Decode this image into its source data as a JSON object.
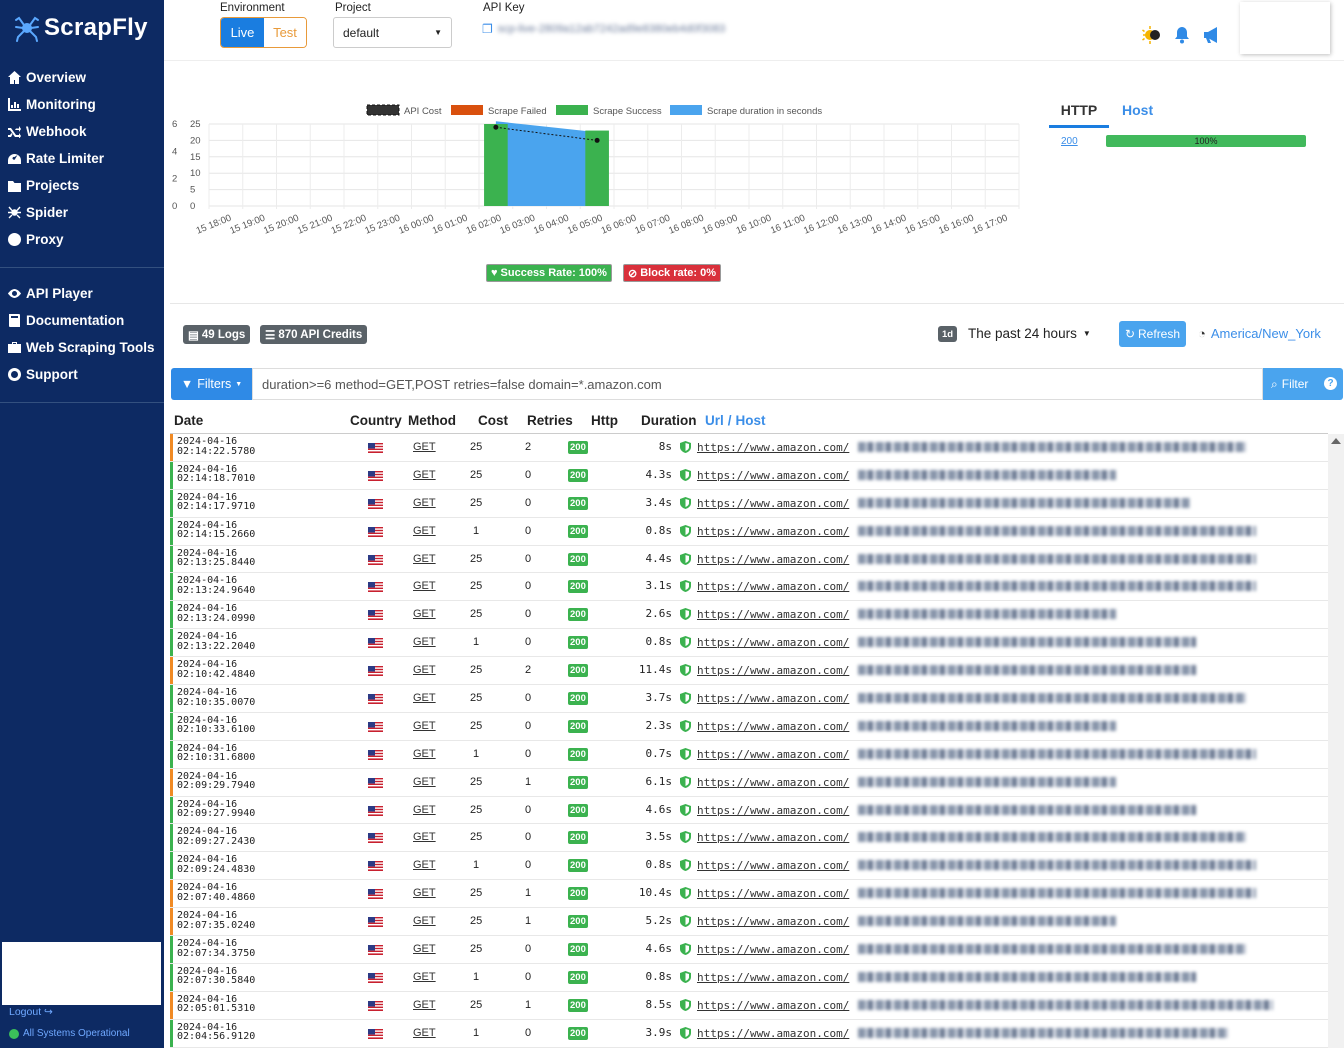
{
  "brand": {
    "name": "ScrapFly"
  },
  "sidebar": {
    "nav_primary": [
      {
        "label": "Overview",
        "icon": "home-icon"
      },
      {
        "label": "Monitoring",
        "icon": "chart-icon"
      },
      {
        "label": "Webhook",
        "icon": "shuffle-icon"
      },
      {
        "label": "Rate Limiter",
        "icon": "speedometer-icon"
      },
      {
        "label": "Projects",
        "icon": "folder-icon"
      },
      {
        "label": "Spider",
        "icon": "spider-icon"
      },
      {
        "label": "Proxy",
        "icon": "globe-icon"
      }
    ],
    "nav_secondary": [
      {
        "label": "API Player",
        "icon": "eye-icon"
      },
      {
        "label": "Documentation",
        "icon": "book-icon"
      },
      {
        "label": "Web Scraping Tools",
        "icon": "briefcase-icon"
      },
      {
        "label": "Support",
        "icon": "lifebuoy-icon"
      }
    ],
    "logout": "Logout",
    "status": "All Systems Operational"
  },
  "header": {
    "environment_label": "Environment",
    "env_live": "Live",
    "env_test": "Test",
    "project_label": "Project",
    "project_value": "default",
    "api_key_label": "API Key",
    "api_key_value": "scp-live-2809a12ab7242ad9e8380eb4d0f3083"
  },
  "chart_data": {
    "type": "bar",
    "legend": [
      "API Cost",
      "Scrape Failed",
      "Scrape Success",
      "Scrape duration in seconds"
    ],
    "categories": [
      "15 18:00",
      "15 19:00",
      "15 20:00",
      "15 21:00",
      "15 22:00",
      "15 23:00",
      "16 00:00",
      "16 01:00",
      "16 02:00",
      "16 03:00",
      "16 04:00",
      "16 05:00",
      "16 06:00",
      "16 07:00",
      "16 08:00",
      "16 09:00",
      "16 10:00",
      "16 11:00",
      "16 12:00",
      "16 13:00",
      "16 14:00",
      "16 15:00",
      "16 16:00",
      "16 17:00"
    ],
    "y_left_ticks": [
      "0",
      "2",
      "4",
      "6"
    ],
    "y_right_ticks": [
      "0",
      "5",
      "10",
      "15",
      "20",
      "25"
    ],
    "success_bars": [
      {
        "category": "16 02:00",
        "value": 25
      },
      {
        "category": "16 05:00",
        "value": 23
      }
    ],
    "duration_area": [
      {
        "category": "16 02:00",
        "value": 6.2
      },
      {
        "category": "16 05:00",
        "value": 5.4
      }
    ],
    "cost_points": [
      {
        "category": "16 02:00",
        "value": 24
      },
      {
        "category": "16 05:00",
        "value": 20
      }
    ]
  },
  "badges": {
    "success_rate": "Success Rate: 100%",
    "block_rate": "Block rate: 0%"
  },
  "http_panel": {
    "tab_http": "HTTP",
    "tab_host": "Host",
    "code": "200",
    "percent": "100%"
  },
  "stats": {
    "logs": "49 Logs",
    "credits": "870 API Credits",
    "period_badge": "1d",
    "period": "The past 24 hours",
    "refresh": "Refresh",
    "timezone": "America/New_York"
  },
  "filter": {
    "button": "Filters",
    "query": "duration>=6 method=GET,POST retries=false domain=*.amazon.com",
    "apply": "Filter",
    "help": "?"
  },
  "table": {
    "headers": {
      "date": "Date",
      "country": "Country",
      "method": "Method",
      "cost": "Cost",
      "retries": "Retries",
      "http": "Http",
      "duration": "Duration",
      "url": "Url",
      "slash": "/",
      "host": "Host"
    },
    "rows": [
      {
        "d": "2024-04-16",
        "t": "02:14:22.5780",
        "method": "GET",
        "cost": "25",
        "retries": "2",
        "http": "200",
        "dur": "8s",
        "url": "https://www.amazon.com/",
        "edge": "#f08a24",
        "pw": 388
      },
      {
        "d": "2024-04-16",
        "t": "02:14:18.7010",
        "method": "GET",
        "cost": "25",
        "retries": "0",
        "http": "200",
        "dur": "4.3s",
        "url": "https://www.amazon.com/",
        "edge": "#3bb24f",
        "pw": 258
      },
      {
        "d": "2024-04-16",
        "t": "02:14:17.9710",
        "method": "GET",
        "cost": "25",
        "retries": "0",
        "http": "200",
        "dur": "3.4s",
        "url": "https://www.amazon.com/",
        "edge": "#3bb24f",
        "pw": 332
      },
      {
        "d": "2024-04-16",
        "t": "02:14:15.2660",
        "method": "GET",
        "cost": "1",
        "retries": "0",
        "http": "200",
        "dur": "0.8s",
        "url": "https://www.amazon.com/",
        "edge": "#3bb24f",
        "pw": 398
      },
      {
        "d": "2024-04-16",
        "t": "02:13:25.8440",
        "method": "GET",
        "cost": "25",
        "retries": "0",
        "http": "200",
        "dur": "4.4s",
        "url": "https://www.amazon.com/",
        "edge": "#3bb24f",
        "pw": 398
      },
      {
        "d": "2024-04-16",
        "t": "02:13:24.9640",
        "method": "GET",
        "cost": "25",
        "retries": "0",
        "http": "200",
        "dur": "3.1s",
        "url": "https://www.amazon.com/",
        "edge": "#3bb24f",
        "pw": 398
      },
      {
        "d": "2024-04-16",
        "t": "02:13:24.0990",
        "method": "GET",
        "cost": "25",
        "retries": "0",
        "http": "200",
        "dur": "2.6s",
        "url": "https://www.amazon.com/",
        "edge": "#3bb24f",
        "pw": 258
      },
      {
        "d": "2024-04-16",
        "t": "02:13:22.2040",
        "method": "GET",
        "cost": "1",
        "retries": "0",
        "http": "200",
        "dur": "0.8s",
        "url": "https://www.amazon.com/",
        "edge": "#3bb24f",
        "pw": 338
      },
      {
        "d": "2024-04-16",
        "t": "02:10:42.4840",
        "method": "GET",
        "cost": "25",
        "retries": "2",
        "http": "200",
        "dur": "11.4s",
        "url": "https://www.amazon.com/",
        "edge": "#f08a24",
        "pw": 338
      },
      {
        "d": "2024-04-16",
        "t": "02:10:35.0070",
        "method": "GET",
        "cost": "25",
        "retries": "0",
        "http": "200",
        "dur": "3.7s",
        "url": "https://www.amazon.com/",
        "edge": "#3bb24f",
        "pw": 388
      },
      {
        "d": "2024-04-16",
        "t": "02:10:33.6100",
        "method": "GET",
        "cost": "25",
        "retries": "0",
        "http": "200",
        "dur": "2.3s",
        "url": "https://www.amazon.com/",
        "edge": "#3bb24f",
        "pw": 258
      },
      {
        "d": "2024-04-16",
        "t": "02:10:31.6800",
        "method": "GET",
        "cost": "1",
        "retries": "0",
        "http": "200",
        "dur": "0.7s",
        "url": "https://www.amazon.com/",
        "edge": "#3bb24f",
        "pw": 398
      },
      {
        "d": "2024-04-16",
        "t": "02:09:29.7940",
        "method": "GET",
        "cost": "25",
        "retries": "1",
        "http": "200",
        "dur": "6.1s",
        "url": "https://www.amazon.com/",
        "edge": "#f08a24",
        "pw": 258
      },
      {
        "d": "2024-04-16",
        "t": "02:09:27.9940",
        "method": "GET",
        "cost": "25",
        "retries": "0",
        "http": "200",
        "dur": "4.6s",
        "url": "https://www.amazon.com/",
        "edge": "#3bb24f",
        "pw": 338
      },
      {
        "d": "2024-04-16",
        "t": "02:09:27.2430",
        "method": "GET",
        "cost": "25",
        "retries": "0",
        "http": "200",
        "dur": "3.5s",
        "url": "https://www.amazon.com/",
        "edge": "#3bb24f",
        "pw": 388
      },
      {
        "d": "2024-04-16",
        "t": "02:09:24.4830",
        "method": "GET",
        "cost": "1",
        "retries": "0",
        "http": "200",
        "dur": "0.8s",
        "url": "https://www.amazon.com/",
        "edge": "#3bb24f",
        "pw": 398
      },
      {
        "d": "2024-04-16",
        "t": "02:07:40.4860",
        "method": "GET",
        "cost": "25",
        "retries": "1",
        "http": "200",
        "dur": "10.4s",
        "url": "https://www.amazon.com/",
        "edge": "#f08a24",
        "pw": 398
      },
      {
        "d": "2024-04-16",
        "t": "02:07:35.0240",
        "method": "GET",
        "cost": "25",
        "retries": "1",
        "http": "200",
        "dur": "5.2s",
        "url": "https://www.amazon.com/",
        "edge": "#f08a24",
        "pw": 258
      },
      {
        "d": "2024-04-16",
        "t": "02:07:34.3750",
        "method": "GET",
        "cost": "25",
        "retries": "0",
        "http": "200",
        "dur": "4.6s",
        "url": "https://www.amazon.com/",
        "edge": "#3bb24f",
        "pw": 388
      },
      {
        "d": "2024-04-16",
        "t": "02:07:30.5840",
        "method": "GET",
        "cost": "1",
        "retries": "0",
        "http": "200",
        "dur": "0.8s",
        "url": "https://www.amazon.com/",
        "edge": "#3bb24f",
        "pw": 338
      },
      {
        "d": "2024-04-16",
        "t": "02:05:01.5310",
        "method": "GET",
        "cost": "25",
        "retries": "1",
        "http": "200",
        "dur": "8.5s",
        "url": "https://www.amazon.com/",
        "edge": "#f08a24",
        "pw": 415
      },
      {
        "d": "2024-04-16",
        "t": "02:04:56.9120",
        "method": "GET",
        "cost": "1",
        "retries": "0",
        "http": "200",
        "dur": "3.9s",
        "url": "https://www.amazon.com/",
        "edge": "#3bb24f",
        "pw": 370
      }
    ]
  },
  "colors": {
    "sidebar_bg": "#0d2a63",
    "primary": "#2f8ae6",
    "success": "#3bb24f",
    "danger": "#d9303b",
    "failed": "#d9500e",
    "duration": "#4aa4ee",
    "retry_edge": "#f08a24"
  }
}
